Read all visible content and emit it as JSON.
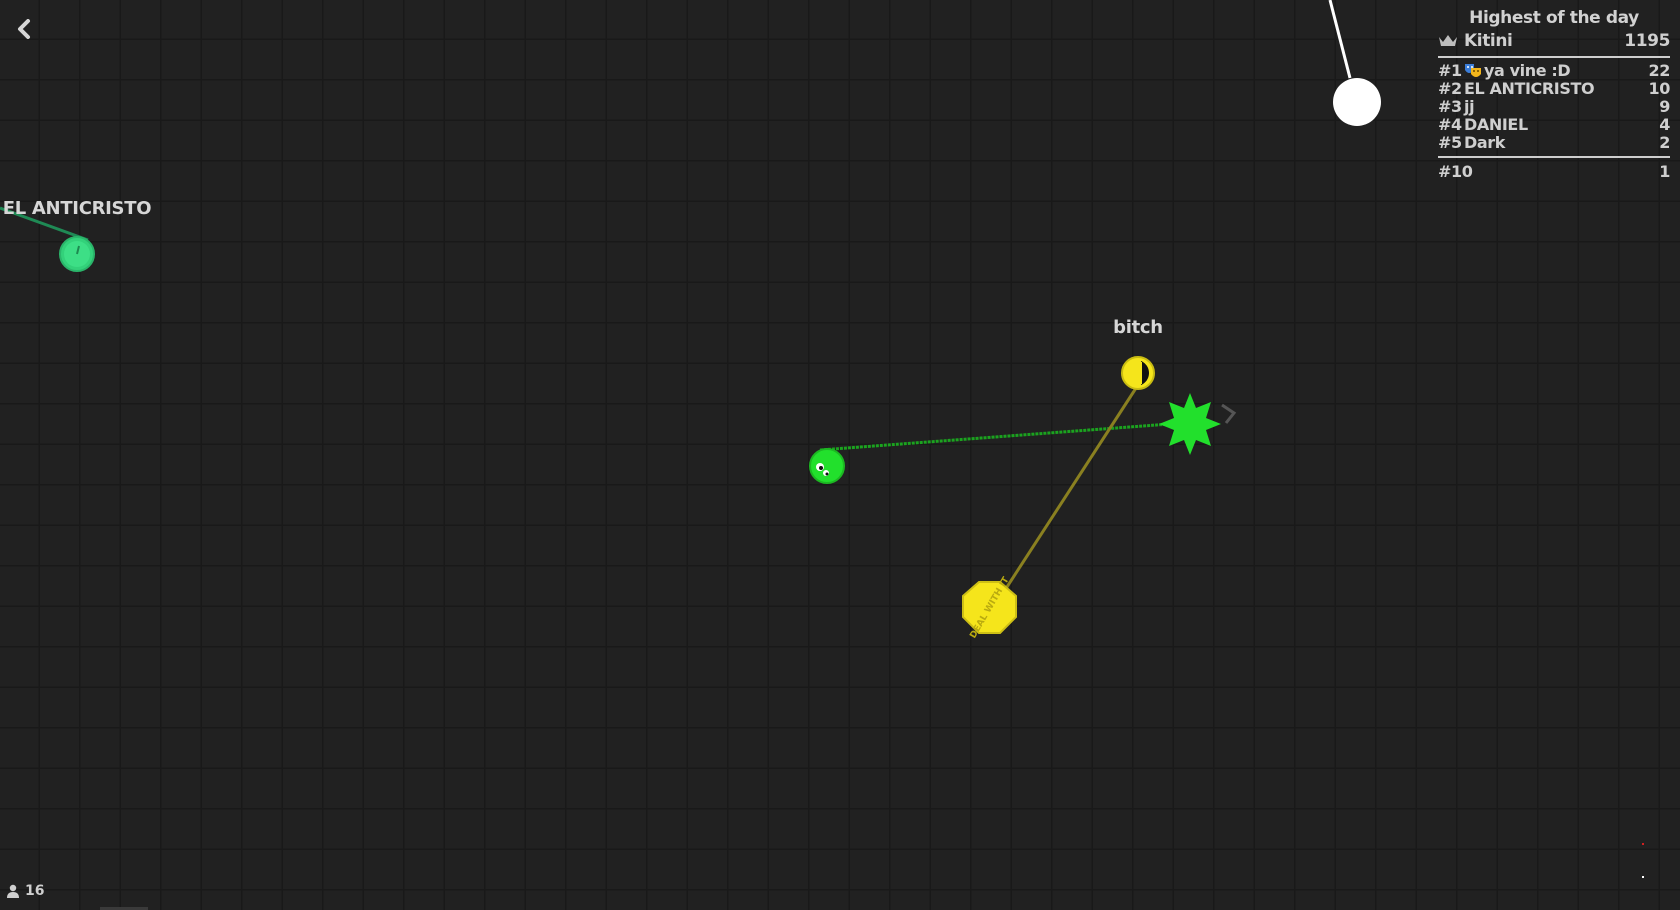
{
  "back_button": {
    "icon": "chevron-left-icon"
  },
  "leaderboard": {
    "title": "Highest of the day",
    "top_player": {
      "icon": "crown-icon",
      "name": "Kitini",
      "score": "1195"
    },
    "entries": [
      {
        "rank": "#1",
        "name": "ya vine :D",
        "score": "22",
        "icon": "theater-masks-icon"
      },
      {
        "rank": "#2",
        "name": "EL ANTICRISTO",
        "score": "10"
      },
      {
        "rank": "#3",
        "name": "jj",
        "score": "9"
      },
      {
        "rank": "#4",
        "name": "DANIEL",
        "score": "4"
      },
      {
        "rank": "#5",
        "name": "Dark",
        "score": "2"
      }
    ],
    "own": {
      "rank": "#10",
      "score": "1"
    }
  },
  "players": [
    {
      "label": "EL ANTICRISTO",
      "color": "#33d17a"
    },
    {
      "label": "bitch",
      "color": "#f5e51b"
    },
    {
      "label": "",
      "color": "#22e02c"
    }
  ],
  "online_count": {
    "icon": "user-icon",
    "value": "16"
  },
  "colors": {
    "background": "#212121",
    "grid": "#191919",
    "green_player": "#22e02c",
    "yellow_player": "#f5e51b",
    "teal_player": "#33d17a"
  }
}
